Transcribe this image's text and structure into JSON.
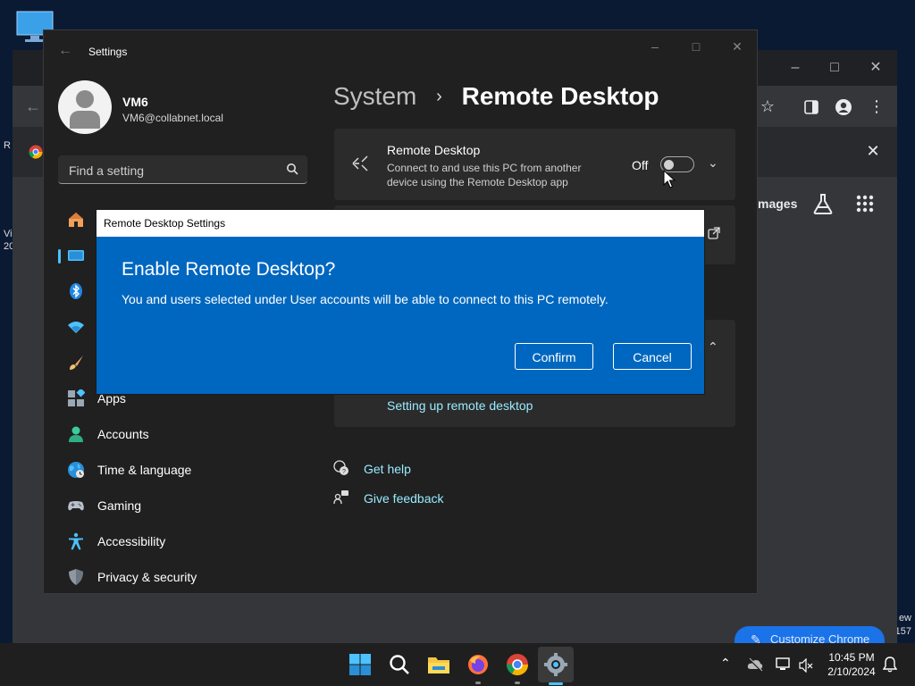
{
  "desktop": {
    "left_text_1": "R",
    "left_text_2": "Vi",
    "left_text_3": "20",
    "right_text_1": "ew",
    "right_text_2": "157"
  },
  "chrome": {
    "tab_text": "mages",
    "customize_label": "Customize Chrome"
  },
  "settings": {
    "window_title": "Settings",
    "user": {
      "name": "VM6",
      "email": "VM6@collabnet.local"
    },
    "search": {
      "placeholder": "Find a setting"
    },
    "nav": [
      {
        "label": "Apps"
      },
      {
        "label": "Accounts"
      },
      {
        "label": "Time & language"
      },
      {
        "label": "Gaming"
      },
      {
        "label": "Accessibility"
      },
      {
        "label": "Privacy & security"
      }
    ],
    "breadcrumb": {
      "parent": "System",
      "current": "Remote Desktop"
    },
    "remote_desktop": {
      "title": "Remote Desktop",
      "description": "Connect to and use this PC from another device using the Remote Desktop app",
      "toggle_label": "Off",
      "toggle_on": false
    },
    "setup_link": "Setting up remote desktop",
    "help": {
      "get_help": "Get help",
      "give_feedback": "Give feedback"
    }
  },
  "dialog": {
    "window_title": "Remote Desktop Settings",
    "heading": "Enable Remote Desktop?",
    "message": "You and users selected under User accounts will be able to connect to this PC remotely.",
    "confirm_label": "Confirm",
    "cancel_label": "Cancel"
  },
  "taskbar": {
    "time": "10:45 PM",
    "date": "2/10/2024"
  },
  "colors": {
    "accent": "#0067c0",
    "link": "#99ebff",
    "nav_accent": "#4cc2ff"
  }
}
